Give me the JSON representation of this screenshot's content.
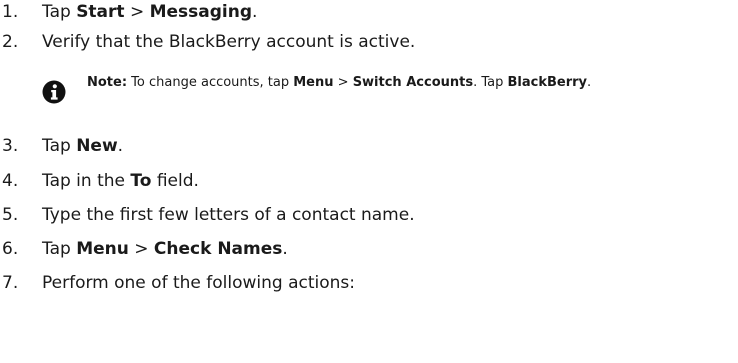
{
  "steps": [
    {
      "num": "1.",
      "parts": [
        {
          "t": "Tap "
        },
        {
          "t": "Start",
          "b": true
        },
        {
          "t": " > "
        },
        {
          "t": "Messaging",
          "b": true
        },
        {
          "t": "."
        }
      ]
    },
    {
      "num": "2.",
      "parts": [
        {
          "t": "Verify that the BlackBerry account is active."
        }
      ]
    },
    {
      "num": "3.",
      "parts": [
        {
          "t": "Tap "
        },
        {
          "t": "New",
          "b": true
        },
        {
          "t": "."
        }
      ]
    },
    {
      "num": "4.",
      "parts": [
        {
          "t": "Tap in the "
        },
        {
          "t": "To",
          "b": true
        },
        {
          "t": " field."
        }
      ]
    },
    {
      "num": "5.",
      "parts": [
        {
          "t": "Type the first few letters of a contact name."
        }
      ]
    },
    {
      "num": "6.",
      "parts": [
        {
          "t": "Tap "
        },
        {
          "t": "Menu",
          "b": true
        },
        {
          "t": " > "
        },
        {
          "t": "Check Names",
          "b": true
        },
        {
          "t": "."
        }
      ]
    },
    {
      "num": "7.",
      "parts": [
        {
          "t": "Perform one of the following actions:"
        }
      ]
    }
  ],
  "note": {
    "icon": "info-icon",
    "parts": [
      {
        "t": "Note:",
        "b": true
      },
      {
        "t": " To change accounts, tap "
      },
      {
        "t": "Menu",
        "b": true
      },
      {
        "t": " > "
      },
      {
        "t": "Switch Accounts",
        "b": true
      },
      {
        "t": ". Tap "
      },
      {
        "t": "BlackBerry",
        "b": true
      },
      {
        "t": "."
      }
    ]
  }
}
